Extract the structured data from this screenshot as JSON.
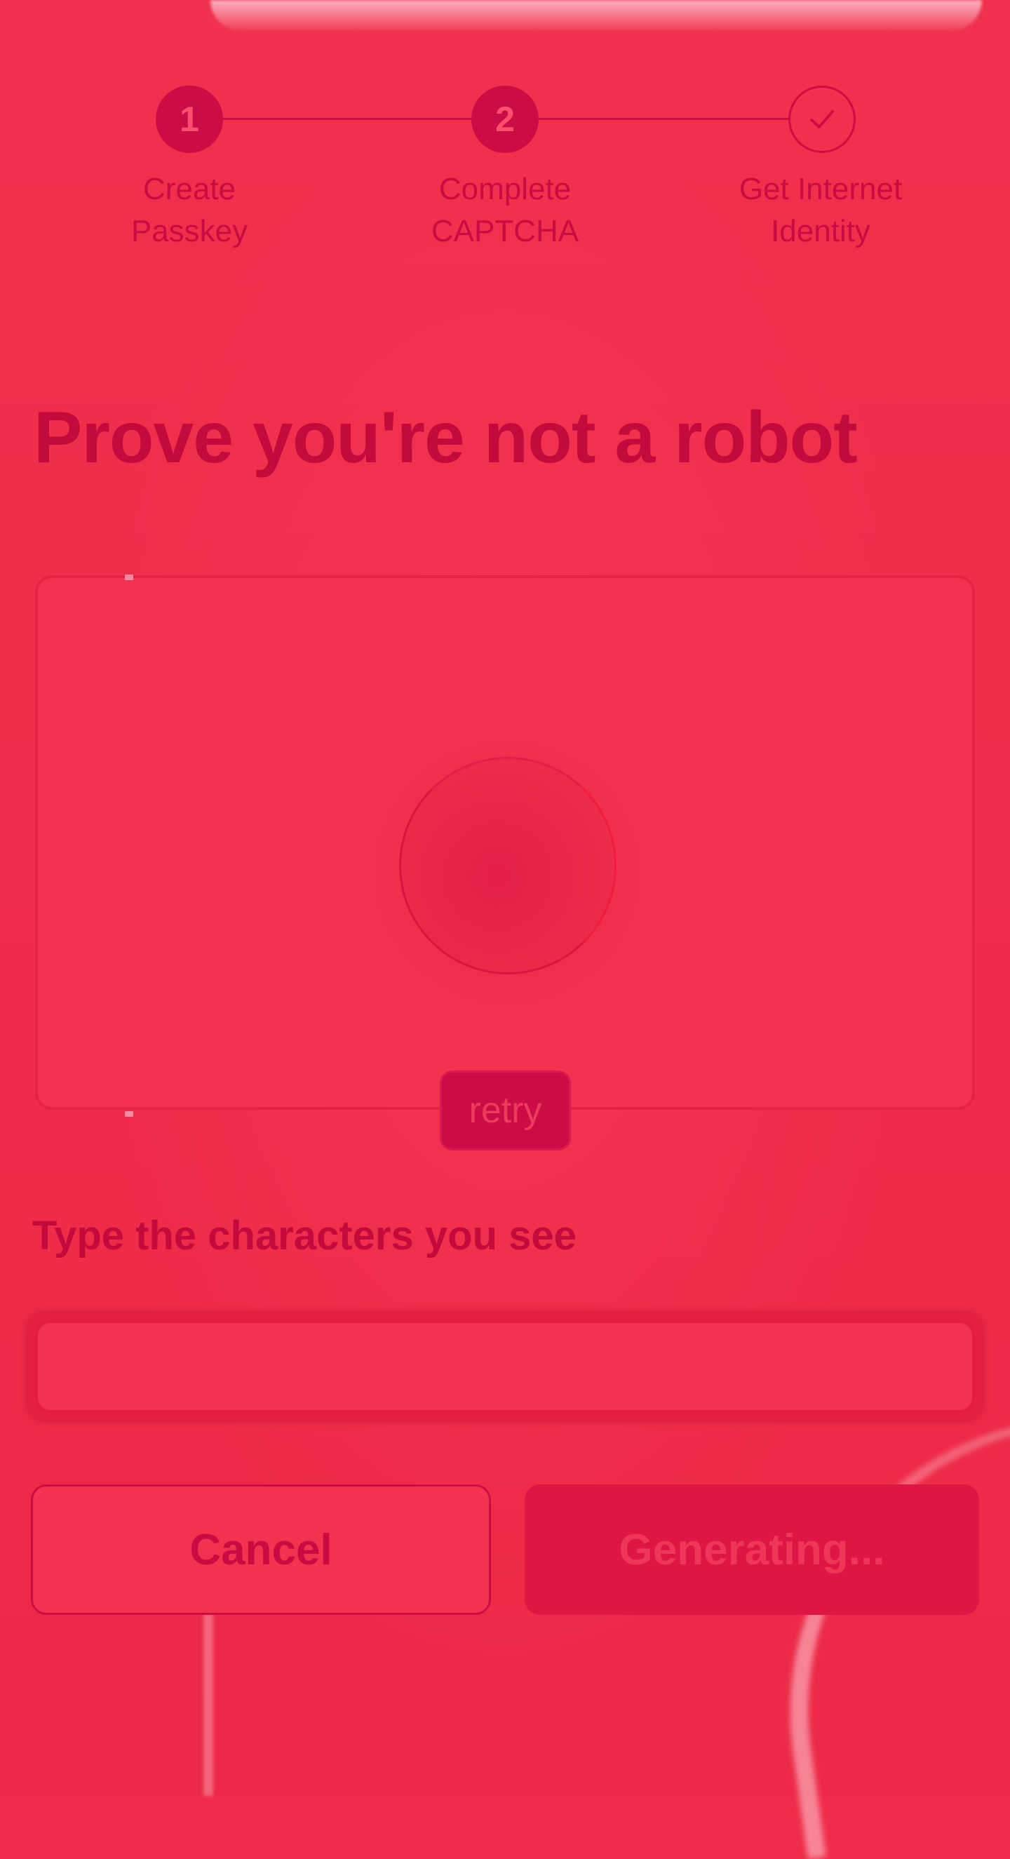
{
  "stepper": {
    "steps": [
      {
        "number": "1",
        "label_line1": "Create",
        "label_line2": "Passkey",
        "state": "active"
      },
      {
        "number": "2",
        "label_line1": "Complete",
        "label_line2": "CAPTCHA",
        "state": "active"
      },
      {
        "number": "✓",
        "label_line1": "Get Internet",
        "label_line2": "Identity",
        "state": "pending"
      }
    ]
  },
  "main": {
    "heading": "Prove you're not a robot",
    "captcha": {
      "status": "loading",
      "retry_label": "retry"
    },
    "input": {
      "label": "Type the characters you see",
      "value": "",
      "placeholder": ""
    },
    "actions": {
      "cancel_label": "Cancel",
      "submit_label": "Generating..."
    }
  },
  "colors": {
    "background": "#ef2d4a",
    "accent": "#cc0d45",
    "text": "#c20a3d"
  },
  "icons": {
    "step3": "checkmark-icon",
    "captcha": "loading-spinner-icon"
  }
}
